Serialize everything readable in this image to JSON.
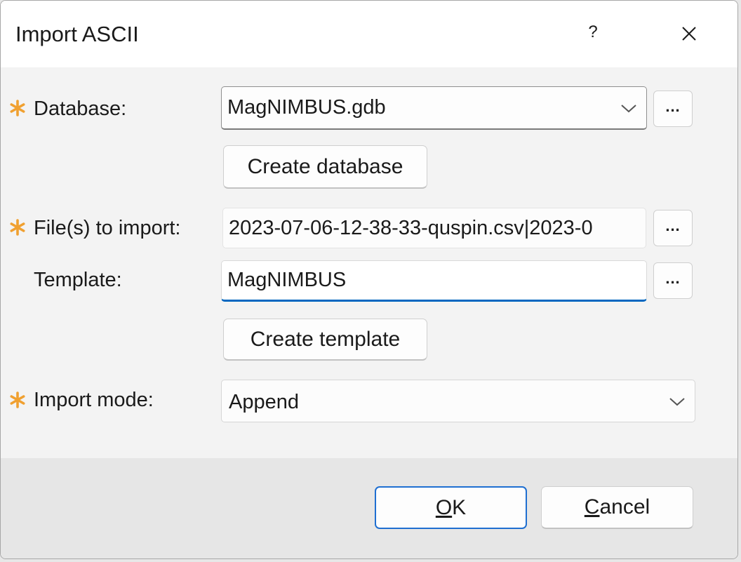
{
  "dialog": {
    "title": "Import ASCII",
    "help_label": "?"
  },
  "database": {
    "label": "Database:",
    "value": "MagNIMBUS.gdb",
    "browse_label": "...",
    "create_button": "Create database"
  },
  "files": {
    "label": "File(s) to import:",
    "value": "2023-07-06-12-38-33-quspin.csv|2023-0",
    "browse_label": "..."
  },
  "template": {
    "label": "Template:",
    "value": "MagNIMBUS",
    "browse_label": "...",
    "create_button": "Create template"
  },
  "import_mode": {
    "label": "Import mode:",
    "value": "Append"
  },
  "footer": {
    "ok_mnemonic": "O",
    "ok_rest": "K",
    "cancel_mnemonic": "C",
    "cancel_rest": "ancel"
  },
  "colors": {
    "required_star": "#f0a030",
    "accent": "#0067c0"
  }
}
